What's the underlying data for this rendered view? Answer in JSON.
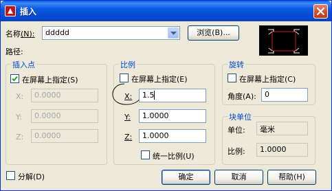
{
  "window": {
    "title": "插入"
  },
  "name": {
    "label": "名称",
    "hotkey": "(N):",
    "value": "ddddd",
    "browse_label": "浏览(B)..."
  },
  "path": {
    "label": "路径:"
  },
  "insertion": {
    "title": "插入点",
    "specify_label": "在屏幕上指定(S)",
    "specify_checked": true,
    "x_label": "X:",
    "x_value": "0.0000",
    "y_label": "Y:",
    "y_value": "0.0000",
    "z_label": "Z:",
    "z_value": "0.0000"
  },
  "scale": {
    "title": "比例",
    "specify_label": "在屏幕上指定(E)",
    "specify_checked": false,
    "x_label": "X:",
    "x_value": "1.5",
    "y_label": "Y:",
    "y_value": "1.0000",
    "z_label": "Z:",
    "z_value": "1.0000",
    "uniform_label": "统一比例(U)",
    "uniform_checked": false
  },
  "rotation": {
    "title": "旋转",
    "specify_label": "在屏幕上指定(C)",
    "specify_checked": false,
    "angle_label": "角度(A):",
    "angle_value": "0"
  },
  "block_unit": {
    "title": "块单位",
    "unit_label": "单位:",
    "unit_value": "毫米",
    "factor_label": "比例:",
    "factor_value": "1.0000"
  },
  "explode": {
    "label": "分解(D)",
    "checked": false
  },
  "buttons": {
    "ok": "确定",
    "cancel": "取消",
    "help": "帮助(H)"
  },
  "colors": {
    "title_bar": "#0a58e0",
    "group_title": "#0046d5",
    "preview_bg": "#000000",
    "preview_line": "#c81e1e"
  }
}
